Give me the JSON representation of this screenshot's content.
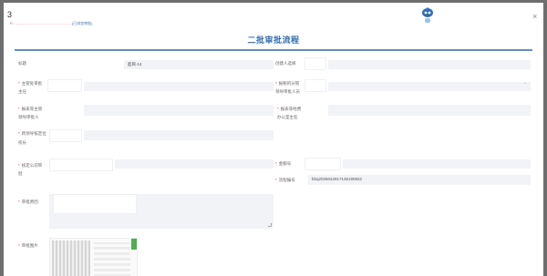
{
  "header": {
    "back_icon": "back-arrow-icon",
    "notice_prefix": "P",
    "notice_text": "...........................................................",
    "notice_link": "(已浏览审批)",
    "close_glyph": "×",
    "logo_icon": "robot-mascot-icon"
  },
  "form": {
    "title": "二批审批流程",
    "fields": {
      "name_label": "标题",
      "name_value": "超目-14",
      "creator_label": "创建人选择",
      "supervisor_label_1": "主管处审批",
      "supervisor_label_2": "主任",
      "dept_label_1": "报税的分管",
      "dept_label_2": "领导审批人员",
      "manager_label_1": "报表等主管",
      "manager_label_2": "领导审批人",
      "finance_label_1": "报表等经费",
      "finance_label_2": "办公室主任",
      "approval_label_1": "跨领导核定位",
      "approval_label_2": "校长",
      "company_label_1": "核定公司审",
      "company_label_2": "批",
      "amount_label": "金额号",
      "serial_label": "流程编号",
      "serial_value": "bbq2026042917135190832",
      "reason_label": "审批原因",
      "attachment_label": "审批图片"
    },
    "required_mark": "*",
    "select_arrow": "⌄"
  }
}
